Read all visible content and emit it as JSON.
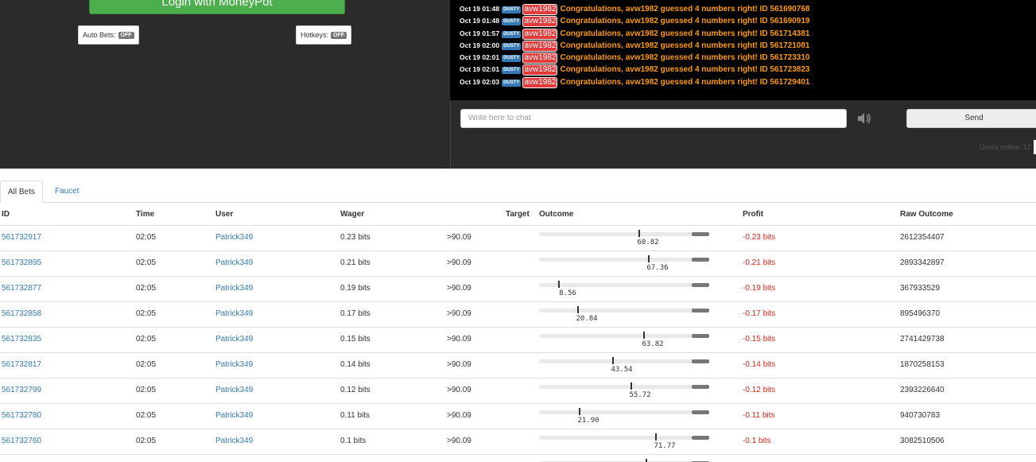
{
  "left_panel": {
    "login_label": "Login with MoneyPot",
    "auto_bets_label": "Auto Bets:",
    "auto_bets_state": "OFF",
    "hotkeys_label": "Hotkeys:",
    "hotkeys_state": "OFF"
  },
  "chat": {
    "lines": [
      {
        "time": "Oct 19 01:48",
        "badge": "DUSTY",
        "user": "avw1982",
        "message": "Congratulations, avw1982 guessed 4 numbers right! ID 561690768"
      },
      {
        "time": "Oct 19 01:48",
        "badge": "DUSTY",
        "user": "avw1982",
        "message": "Congratulations, avw1982 guessed 4 numbers right! ID 561690919"
      },
      {
        "time": "Oct 19 01:57",
        "badge": "DUSTY",
        "user": "avw1982",
        "message": "Congratulations, avw1982 guessed 4 numbers right! ID 561714381"
      },
      {
        "time": "Oct 19 02:00",
        "badge": "DUSTY",
        "user": "avw1982",
        "message": "Congratulations, avw1982 guessed 4 numbers right! ID 561721081"
      },
      {
        "time": "Oct 19 02:01",
        "badge": "DUSTY",
        "user": "avw1982",
        "message": "Congratulations, avw1982 guessed 4 numbers right! ID 561723310"
      },
      {
        "time": "Oct 19 02:01",
        "badge": "DUSTY",
        "user": "avw1982",
        "message": "Congratulations, avw1982 guessed 4 numbers right! ID 561723823"
      },
      {
        "time": "Oct 19 02:03",
        "badge": "DUSTY",
        "user": "avw1982",
        "message": "Congratulations, avw1982 guessed 4 numbers right! ID 561729401"
      }
    ],
    "input_placeholder": "Write here to chat",
    "speaker_icon": "speaker-icon",
    "send_label": "Send",
    "users_online": "Users online: 12"
  },
  "tabs": [
    {
      "label": "All Bets",
      "active": true
    },
    {
      "label": "Faucet",
      "active": false
    }
  ],
  "table": {
    "headers": {
      "id": "ID",
      "time": "Time",
      "user": "User",
      "wager": "Wager",
      "target": "Target",
      "outcome": "Outcome",
      "profit": "Profit",
      "raw": "Raw Outcome"
    },
    "rows": [
      {
        "id": "561732917",
        "time": "02:05",
        "user": "Patrick349",
        "wager": "0.23 bits",
        "target": ">90.09",
        "outcome": 60.82,
        "outcome_label": "60.82",
        "profit": "-0.23 bits",
        "raw": "2612354407"
      },
      {
        "id": "561732895",
        "time": "02:05",
        "user": "Patrick349",
        "wager": "0.21 bits",
        "target": ">90.09",
        "outcome": 67.36,
        "outcome_label": "67.36",
        "profit": "-0.21 bits",
        "raw": "2893342897"
      },
      {
        "id": "561732877",
        "time": "02:05",
        "user": "Patrick349",
        "wager": "0.19 bits",
        "target": ">90.09",
        "outcome": 8.56,
        "outcome_label": "8.56",
        "profit": "-0.19 bits",
        "raw": "367933529"
      },
      {
        "id": "561732858",
        "time": "02:05",
        "user": "Patrick349",
        "wager": "0.17 bits",
        "target": ">90.09",
        "outcome": 20.84,
        "outcome_label": "20.84",
        "profit": "-0.17 bits",
        "raw": "895496370"
      },
      {
        "id": "561732835",
        "time": "02:05",
        "user": "Patrick349",
        "wager": "0.15 bits",
        "target": ">90.09",
        "outcome": 63.82,
        "outcome_label": "63.82",
        "profit": "-0.15 bits",
        "raw": "2741429738"
      },
      {
        "id": "561732817",
        "time": "02:05",
        "user": "Patrick349",
        "wager": "0.14 bits",
        "target": ">90.09",
        "outcome": 43.54,
        "outcome_label": "43.54",
        "profit": "-0.14 bits",
        "raw": "1870258153"
      },
      {
        "id": "561732799",
        "time": "02:05",
        "user": "Patrick349",
        "wager": "0.12 bits",
        "target": ">90.09",
        "outcome": 55.72,
        "outcome_label": "55.72",
        "profit": "-0.12 bits",
        "raw": "2393226640"
      },
      {
        "id": "561732780",
        "time": "02:05",
        "user": "Patrick349",
        "wager": "0.11 bits",
        "target": ">90.09",
        "outcome": 21.9,
        "outcome_label": "21.90",
        "profit": "-0.11 bits",
        "raw": "940730783"
      },
      {
        "id": "561732760",
        "time": "02:05",
        "user": "Patrick349",
        "wager": "0.1 bits",
        "target": ">90.09",
        "outcome": 71.77,
        "outcome_label": "71.77",
        "profit": "-0.1 bits",
        "raw": "3082510506"
      }
    ],
    "partial_row_outcome": 65.5
  },
  "colors": {
    "login_green": "#4cae4c",
    "link_blue": "#337ab7",
    "loss_red": "#e0241b",
    "chat_highlight": "#ff9d00",
    "user_tag_red": "#e23b3b",
    "dark_bg": "#2b2b2b"
  }
}
